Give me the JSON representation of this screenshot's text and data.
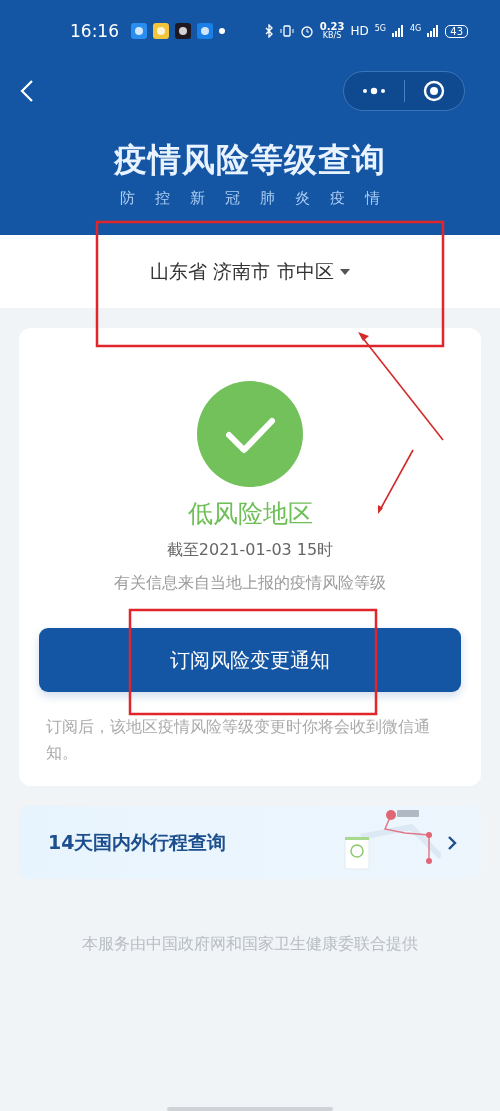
{
  "status_bar": {
    "time": "16:16",
    "speed": "0.23",
    "speed_unit": "KB/S",
    "hd": "HD",
    "net_1": "5G",
    "net_2": "4G",
    "battery": "43"
  },
  "header": {
    "title": "疫情风险等级查询",
    "subtitle": [
      "防",
      "控",
      "新",
      "冠",
      "肺",
      "炎",
      "疫",
      "情"
    ]
  },
  "location": {
    "text": "山东省 济南市 市中区"
  },
  "risk_card": {
    "level_text": "低风险地区",
    "as_of": "截至2021-01-03 15时",
    "source": "有关信息来自当地上报的疫情风险等级",
    "button": "订阅风险变更通知",
    "note": "订阅后，该地区疫情风险等级变更时你将会收到微信通知。"
  },
  "trip_card": {
    "title": "14天国内外行程查询"
  },
  "footer": "本服务由中国政府网和国家卫生健康委联合提供"
}
